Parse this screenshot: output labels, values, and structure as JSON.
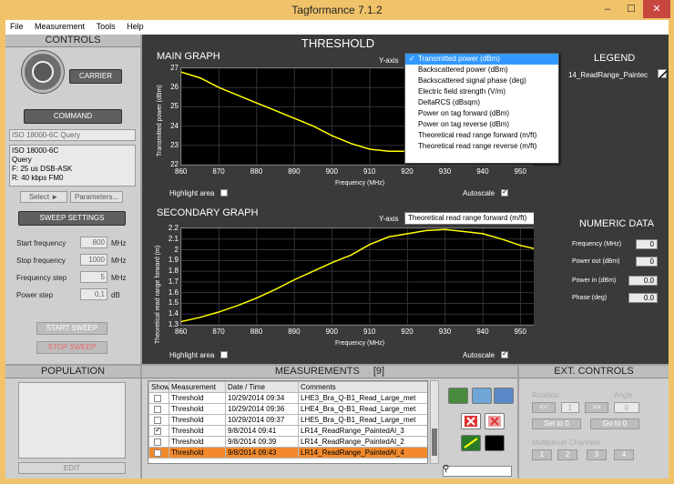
{
  "window": {
    "title": "Tagformance 7.1.2",
    "min": "–",
    "max": "☐",
    "close": "✕"
  },
  "menu": [
    "File",
    "Measurement",
    "Tools",
    "Help"
  ],
  "controls": {
    "header": "CONTROLS",
    "carrier_label": "CARRIER",
    "command_label": "COMMAND",
    "protocol": "ISO 18000-6C Query",
    "info": [
      "ISO 18000-6C",
      "Query",
      "F: 25 us DSB-ASK",
      "R: 40 kbps FM0"
    ],
    "select_label": "Select ►",
    "parameters_label": "Parameters...",
    "sweep_settings_label": "SWEEP SETTINGS",
    "fields": [
      {
        "label": "Start frequency",
        "value": "800",
        "unit": "MHz"
      },
      {
        "label": "Stop frequency",
        "value": "1000",
        "unit": "MHz"
      },
      {
        "label": "Frequency step",
        "value": "5",
        "unit": "MHz"
      },
      {
        "label": "Power step",
        "value": "0,1",
        "unit": "dB"
      }
    ],
    "start_sweep": "START SWEEP",
    "stop_sweep": "STOP SWEEP"
  },
  "threshold": {
    "header": "THRESHOLD",
    "main_graph": {
      "title": "MAIN GRAPH",
      "yaxis_label": "Y-axis",
      "ylabel": "Transmitted power (dBm)",
      "xlabel": "Frequency (MHz)",
      "highlight_label": "Highlight area",
      "autoscale_label": "Autoscale"
    },
    "dropdown": {
      "options": [
        "Transmitted power (dBm)",
        "Backscattered power (dBm)",
        "Backscattered signal phase (deg)",
        "Electric field strength (V/m)",
        "DeltaRCS (dBsqm)",
        "Power on tag forward (dBm)",
        "Power on tag reverse (dBm)",
        "Theoretical read range forward (m/ft)",
        "Theoretical read range reverse (m/ft)"
      ],
      "selected_index": 0,
      "check": "✓"
    },
    "secondary_graph": {
      "title": "SECONDARY GRAPH",
      "yaxis_label": "Y-axis",
      "yaxis_value": "Theoretical read range forward (m/ft)",
      "ylabel": "Theoretical read range forward (m)",
      "xlabel": "Frequency (MHz)",
      "highlight_label": "Highlight area",
      "autoscale_label": "Autoscale"
    },
    "legend": {
      "title": "LEGEND",
      "entry": "14_ReadRange_Paintec"
    },
    "numeric": {
      "title": "NUMERIC DATA",
      "rows": [
        {
          "label": "Frequency (MHz)",
          "value": "0"
        },
        {
          "label": "Power out (dBm)",
          "value": "0"
        },
        {
          "label": "Power in (dBm)",
          "value": "0.0"
        },
        {
          "label": "Phase (deg)",
          "value": "0.0"
        }
      ]
    }
  },
  "chart_data": [
    {
      "type": "line",
      "title": "MAIN GRAPH",
      "xlabel": "Frequency (MHz)",
      "ylabel": "Transmitted power (dBm)",
      "xlim": [
        860,
        960
      ],
      "ylim": [
        22,
        27
      ],
      "x_ticks": [
        "860",
        "870",
        "880",
        "890",
        "900",
        "910",
        "920",
        "930",
        "940",
        "950",
        "960"
      ],
      "y_ticks": [
        "22",
        "23",
        "24",
        "25",
        "26",
        "27"
      ],
      "x": [
        860,
        865,
        870,
        875,
        880,
        885,
        890,
        895,
        900,
        905,
        910,
        915,
        920,
        925,
        930
      ],
      "y": [
        26.8,
        26.5,
        26.0,
        25.6,
        25.2,
        24.8,
        24.4,
        24.0,
        23.5,
        23.1,
        22.8,
        22.7,
        22.7,
        22.6,
        22.6
      ],
      "series": [
        {
          "name": "14_ReadRange_Paintec",
          "color": "#ffff00"
        }
      ],
      "grid": true
    },
    {
      "type": "line",
      "title": "SECONDARY GRAPH",
      "xlabel": "Frequency (MHz)",
      "ylabel": "Theoretical read range forward (m)",
      "xlim": [
        860,
        960
      ],
      "ylim": [
        1.3,
        2.2
      ],
      "x_ticks": [
        "860",
        "870",
        "880",
        "890",
        "900",
        "910",
        "920",
        "930",
        "940",
        "950",
        "960"
      ],
      "y_ticks": [
        "1.3",
        "1.4",
        "1.5",
        "1.6",
        "1.7",
        "1.8",
        "1.9",
        "2",
        "2.1",
        "2.2"
      ],
      "x": [
        860,
        865,
        870,
        875,
        880,
        885,
        890,
        895,
        900,
        905,
        910,
        915,
        920,
        925,
        930,
        935,
        940,
        945,
        950,
        955,
        960
      ],
      "y": [
        1.33,
        1.37,
        1.42,
        1.48,
        1.55,
        1.63,
        1.72,
        1.8,
        1.88,
        1.95,
        2.05,
        2.12,
        2.15,
        2.18,
        2.19,
        2.17,
        2.15,
        2.1,
        2.04,
        2.0,
        1.97
      ],
      "series": [
        {
          "name": "14_ReadRange_Paintec",
          "color": "#ffff00"
        }
      ],
      "grid": true
    }
  ],
  "population": {
    "header": "POPULATION",
    "edit_label": "EDIT"
  },
  "measurements": {
    "header": "MEASUREMENTS",
    "count": "[9]",
    "columns": [
      "Show",
      "Measurement",
      "Date / Time",
      "Comments"
    ],
    "rows": [
      {
        "show": false,
        "measurement": "Threshold",
        "date": "10/29/2014  09:34",
        "comment": "LHE3_Bra_Q-B1_Read_Large_met"
      },
      {
        "show": false,
        "measurement": "Threshold",
        "date": "10/29/2014  09:36",
        "comment": "LHE4_Bra_Q-B1_Read_Large_met"
      },
      {
        "show": false,
        "measurement": "Threshold",
        "date": "10/29/2014  09:37",
        "comment": "LHE5_Bra_Q-B1_Read_Large_met"
      },
      {
        "show": true,
        "measurement": "Threshold",
        "date": "9/8/2014   09:41",
        "comment": "LR14_ReadRange_PaintedAl_3"
      },
      {
        "show": false,
        "measurement": "Threshold",
        "date": "9/8/2014   09:39",
        "comment": "LR14_ReadRange_PaintedAl_2"
      },
      {
        "show": false,
        "measurement": "Threshold",
        "date": "9/8/2014   09:43",
        "comment": "LR14_ReadRange_PaintedAl_4"
      }
    ],
    "highlight_row": 5
  },
  "ext_controls": {
    "header": "EXT. CONTROLS",
    "rotation_label": "Rotation",
    "angle_label": "Angle",
    "prev": "<<",
    "rotation_value": "1",
    "next": ">>",
    "angle_value": "0",
    "set_to_0": "Set to 0",
    "go_to_0": "Go to 0",
    "mux_label": "Multiplexer Channels",
    "channels": [
      "1",
      "2",
      "3",
      "4"
    ]
  }
}
